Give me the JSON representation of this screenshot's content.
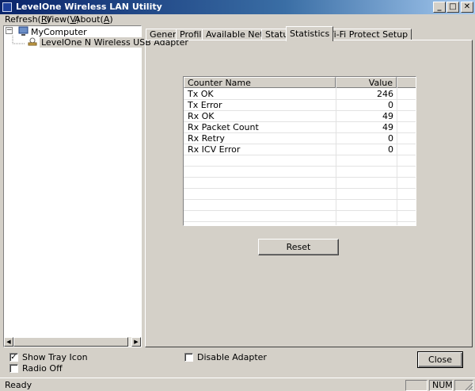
{
  "window": {
    "title": "LevelOne Wireless LAN Utility",
    "minimize": "_",
    "maximize": "□",
    "close": "✕"
  },
  "menu": {
    "items": [
      {
        "label": "Refresh",
        "accel": "R"
      },
      {
        "label": "View",
        "accel": "V"
      },
      {
        "label": "About",
        "accel": "A"
      }
    ]
  },
  "tree": {
    "root": "MyComputer",
    "child": "LevelOne N Wireless USB Adapter",
    "expander": "⊟"
  },
  "tabs": [
    "General",
    "Profile",
    "Available Network",
    "Status",
    "Statistics",
    "Wi-Fi Protect Setup"
  ],
  "active_tab": "Statistics",
  "stats": {
    "columns": [
      "Counter Name",
      "Value"
    ],
    "rows": [
      {
        "name": "Tx OK",
        "value": "246"
      },
      {
        "name": "Tx Error",
        "value": "0"
      },
      {
        "name": "Rx OK",
        "value": "49"
      },
      {
        "name": "Rx Packet Count",
        "value": "49"
      },
      {
        "name": "Rx Retry",
        "value": "0"
      },
      {
        "name": "Rx ICV Error",
        "value": "0"
      }
    ]
  },
  "reset_label": "Reset",
  "options": {
    "show_tray_icon": {
      "label": "Show Tray Icon",
      "checked": true,
      "mark": "✓"
    },
    "radio_off": {
      "label": "Radio Off",
      "checked": false
    },
    "disable_adapter": {
      "label": "Disable Adapter",
      "checked": false
    }
  },
  "close_label": "Close",
  "status": {
    "text": "Ready",
    "num": "NUM"
  }
}
